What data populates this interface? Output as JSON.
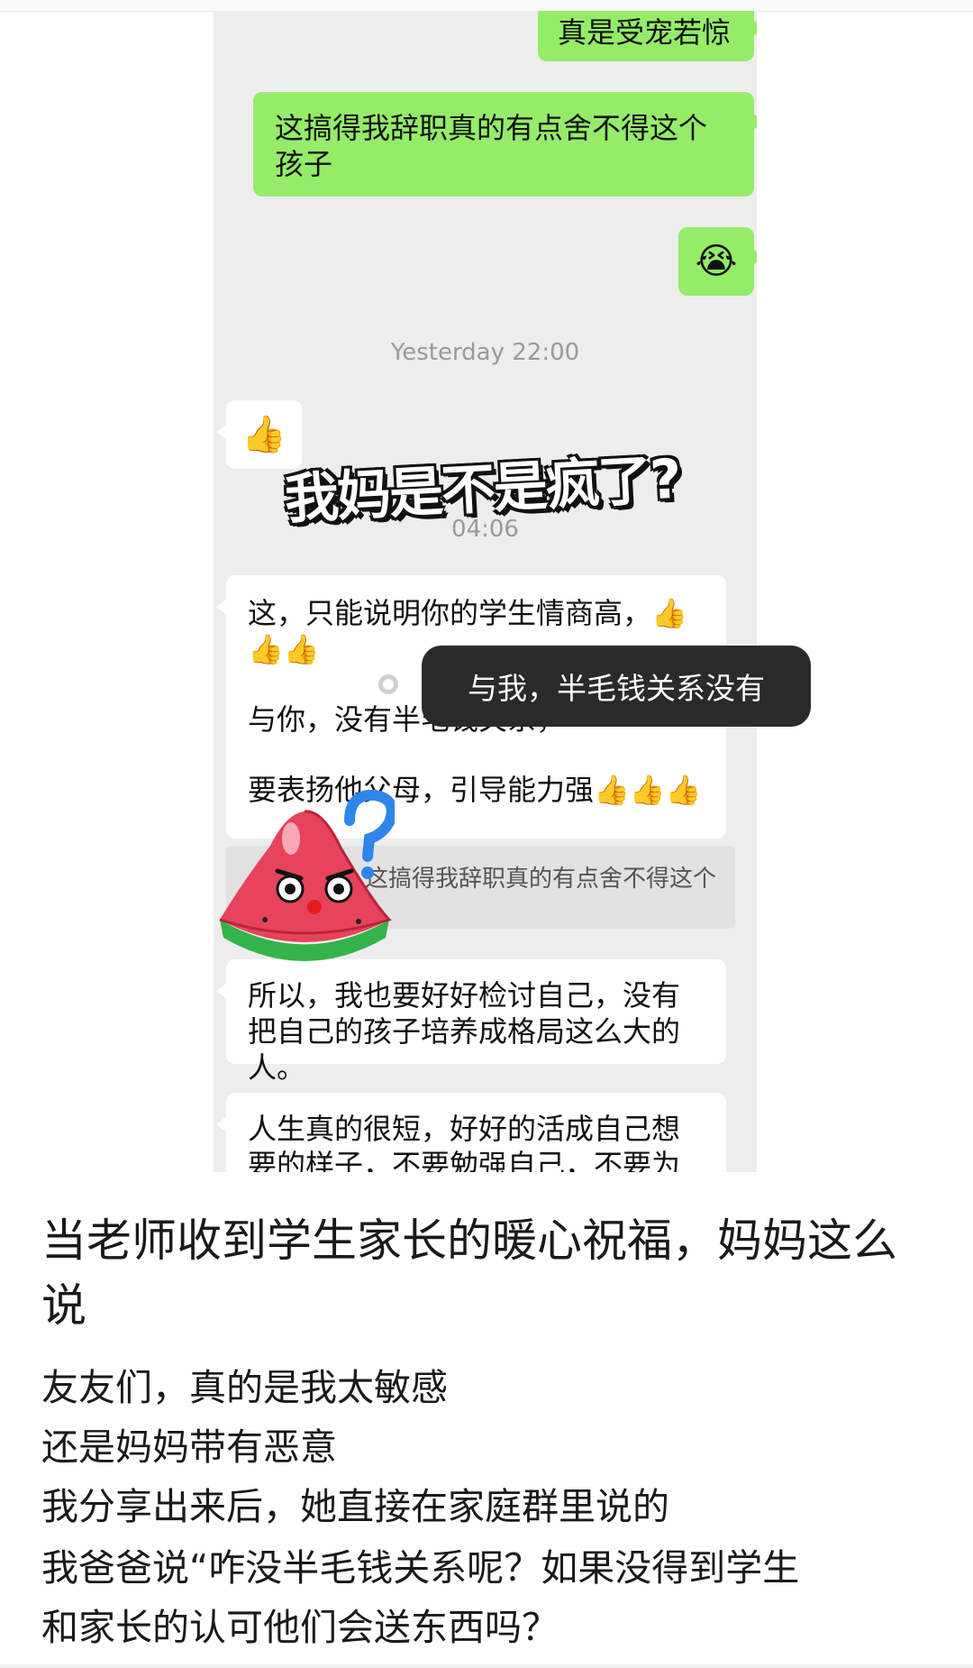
{
  "chat": {
    "msg_sent_1": "真是受宠若惊",
    "msg_sent_2": "这搞得我辞职真的有点舍不得这个孩子",
    "msg_sent_emoji": "😭",
    "time_1": "Yesterday 22:00",
    "msg_recv_emoji": "👍",
    "time_2": "04:06",
    "msg_recv_long": {
      "line1": "这，只能说明你的学生情商高，👍👍👍",
      "line2": "与你，没有半毛钱关系，",
      "line3": "要表扬他父母，引导能力强👍👍👍"
    },
    "quote_text": "这搞得我辞职真的有点舍不得这个",
    "msg_recv_3": "所以，我也要好好检讨自己，没有把自己的孩子培养成格局这么大的人。",
    "msg_recv_4": "人生真的很短，好好的活成自己想要的样子，不要勉强自己，不要为难别"
  },
  "overlay": {
    "title": "我妈是不是疯了?",
    "toast": "与我，半毛钱关系没有",
    "sticker_icon": "watermelon-sticker-icon"
  },
  "article": {
    "title": "当老师收到学生家长的暖心祝福，妈妈这么说",
    "lines": [
      "友友们，真的是我太敏感",
      "还是妈妈带有恶意",
      "我分享出来后，她直接在家庭群里说的",
      "我爸爸说“咋没半毛钱关系呢？如果没得到学生",
      "和家长的认可他们会送东西吗？"
    ]
  }
}
